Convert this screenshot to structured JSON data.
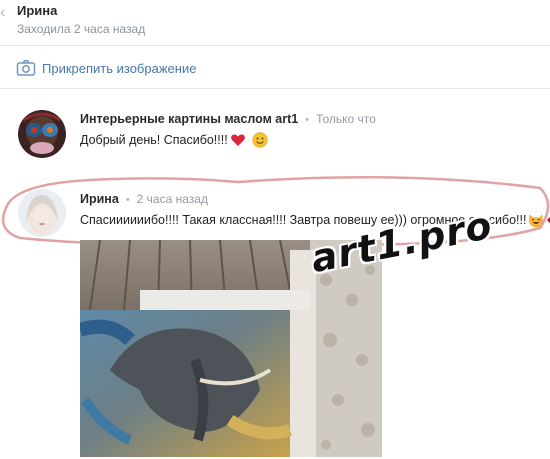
{
  "header": {
    "name": "Ирина",
    "status": "Заходила 2 часа назад"
  },
  "attach": {
    "label": "Прикрепить изображение",
    "icon": "camera-icon"
  },
  "messages": [
    {
      "author": "Интерьерные картины маслом art1",
      "dot": "•",
      "time": "Только что",
      "text": "Добрый день! Спасибо!!!!",
      "emojis": [
        "heart-emoji",
        "smile-emoji"
      ]
    },
    {
      "author": "Ирина",
      "dot": "•",
      "time": "2 часа назад",
      "text": "Спасиииииибо!!!! Такая классная!!!! Завтра повешу ее))) огромное спасибо!!!",
      "emojis": [
        "cat-smile-emoji",
        "kiss-lips-emoji"
      ]
    }
  ],
  "watermark": "art1.pro",
  "colors": {
    "link": "#4a76a8",
    "meta": "#939aa1",
    "circle_mark": "#e0a2a2"
  }
}
